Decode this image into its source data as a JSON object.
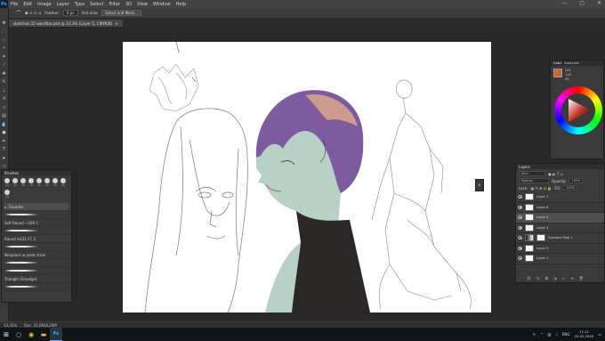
{
  "app": {
    "logo": "Ps"
  },
  "menu": [
    "File",
    "Edit",
    "Image",
    "Layer",
    "Type",
    "Select",
    "Filter",
    "3D",
    "View",
    "Window",
    "Help"
  ],
  "window_controls": [
    "—",
    "▢",
    "✕"
  ],
  "options_bar": {
    "feather_label": "Feather:",
    "feather_value": "0 px",
    "antialias_label": "Anti-alias",
    "select_mask_button": "Select and Mask..."
  },
  "document_tab": {
    "title": "sketches 22 wordfpe.psd @ 33,3% (Layer 5, CMYK/8)",
    "close": "×"
  },
  "tools": [
    "move",
    "marquee",
    "lasso",
    "wand",
    "crop",
    "eyedropper",
    "heal",
    "brush",
    "stamp",
    "history",
    "eraser",
    "gradient",
    "blur",
    "dodge",
    "pen",
    "type",
    "path",
    "shape",
    "hand",
    "zoom"
  ],
  "brushes_panel": {
    "title": "Brushes",
    "tip_sizes": [
      "30",
      "30",
      "30",
      "25",
      "25",
      "36",
      "30",
      "60",
      "41"
    ],
    "groups": [
      {
        "name": "Favorite",
        "selected": true
      },
      {
        "name": "Soft Round ~100 1"
      },
      {
        "name": "Round ink31 FC 2"
      },
      {
        "name": "Nonplace w paint strok"
      },
      {
        "name": "Triangle (Smudge)"
      }
    ]
  },
  "color_panel": {
    "tabs": [
      "Color",
      "Swatches"
    ],
    "fg": "#d2652a",
    "values": [
      "241",
      "119",
      "45"
    ]
  },
  "layers_panel": {
    "title": "Layers",
    "kind": "Kind",
    "blend_mode": "Normal",
    "opacity_label": "Opacity:",
    "opacity_value": "100%",
    "lock_label": "Lock:",
    "fill_label": "Fill:",
    "fill_value": "100%",
    "layers": [
      {
        "name": "Layer 7"
      },
      {
        "name": "Layer 6"
      },
      {
        "name": "Layer 5",
        "selected": true
      },
      {
        "name": "Layer 4"
      },
      {
        "name": "Gradient Map 1",
        "type": "adjustment"
      },
      {
        "name": "Layer 3"
      },
      {
        "name": "Layer 2"
      },
      {
        "name": "Layer 1"
      }
    ],
    "footer_icons": [
      "link",
      "fx",
      "mask",
      "adj",
      "group",
      "new",
      "trash"
    ]
  },
  "status": {
    "zoom": "33,33%",
    "doc": "Doc: 31,6M/8,24M"
  },
  "taskbar": {
    "apps": [
      "search",
      "chrome",
      "explorer",
      "photoshop"
    ],
    "tray_lang": "ENG",
    "time": "17:12",
    "date": "20.02.2020"
  }
}
